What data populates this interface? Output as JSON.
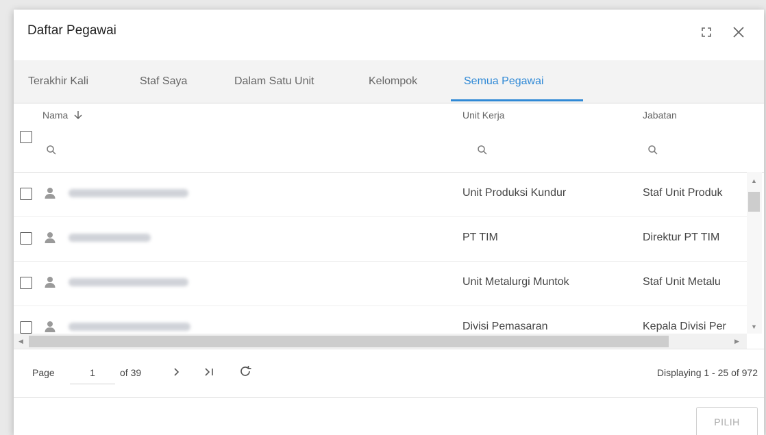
{
  "dialog": {
    "title": "Daftar Pegawai"
  },
  "icons": {
    "maximize": "maximize-icon",
    "close": "close-icon",
    "sort": "arrow-down-icon",
    "search": "search-icon",
    "avatar": "person-icon",
    "next": "chevron-right-icon",
    "last": "last-page-icon",
    "refresh": "refresh-icon"
  },
  "tabs": [
    {
      "label": "Terakhir Kali",
      "active": false
    },
    {
      "label": "Staf Saya",
      "active": false
    },
    {
      "label": "Dalam Satu Unit",
      "active": false
    },
    {
      "label": "Kelompok",
      "active": false
    },
    {
      "label": "Semua Pegawai",
      "active": true
    }
  ],
  "columns": {
    "nama": "Nama",
    "unit_kerja": "Unit Kerja",
    "jabatan": "Jabatan"
  },
  "rows": [
    {
      "unit": "Unit Produksi Kundur",
      "jabatan": "Staf Unit Produk"
    },
    {
      "unit": "PT TIM",
      "jabatan": "Direktur PT TIM"
    },
    {
      "unit": "Unit Metalurgi Muntok",
      "jabatan": "Staf Unit Metalu"
    },
    {
      "unit": "Divisi Pemasaran",
      "jabatan": "Kepala Divisi Per"
    }
  ],
  "pager": {
    "page_label": "Page",
    "current_page": "1",
    "of_label": "of 39",
    "displaying": "Displaying 1 - 25 of 972"
  },
  "footer": {
    "select_label": "PILIH"
  },
  "colors": {
    "accent": "#2f89d6",
    "tab_bg": "#f3f3f3"
  }
}
